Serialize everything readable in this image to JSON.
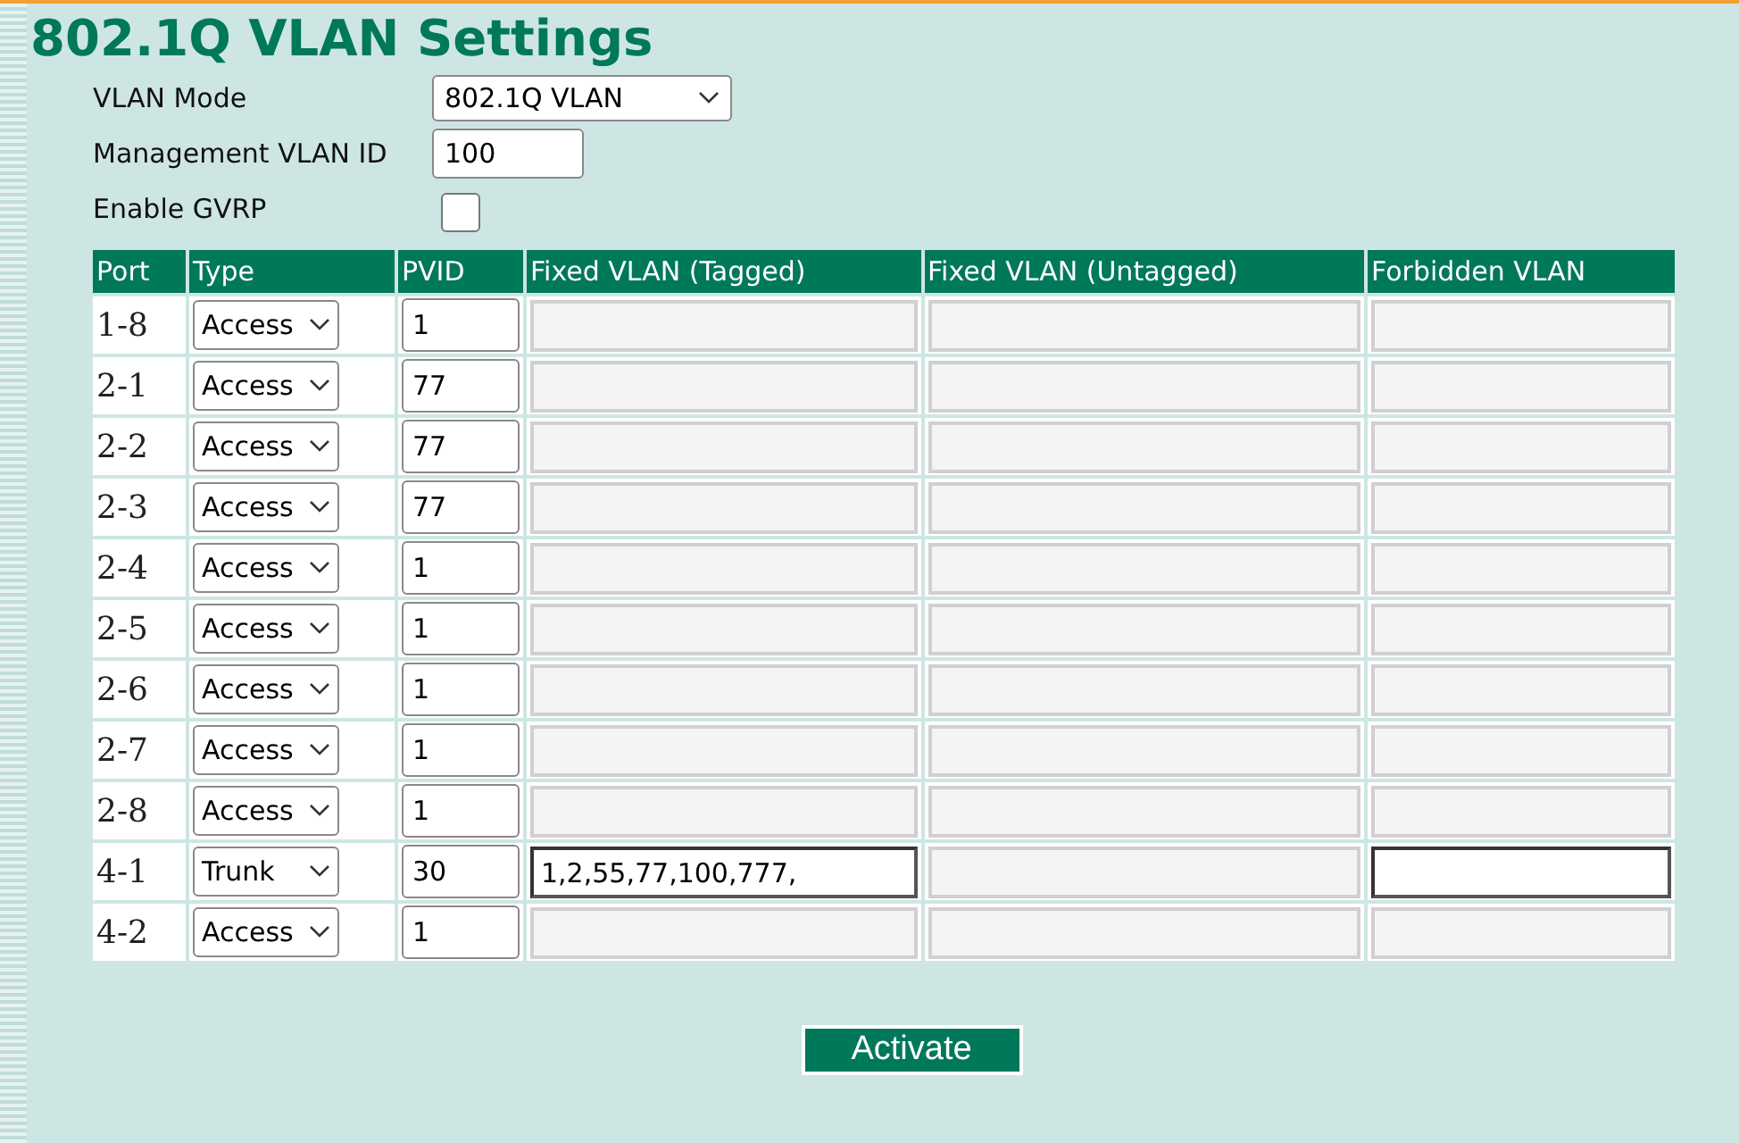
{
  "title": "802.1Q VLAN Settings",
  "settings": {
    "vlan_mode": {
      "label": "VLAN Mode",
      "value": "802.1Q VLAN"
    },
    "management_vlan_id": {
      "label": "Management VLAN ID",
      "value": "100"
    },
    "enable_gvrp": {
      "label": "Enable GVRP",
      "checked": false
    }
  },
  "table": {
    "columns": [
      "Port",
      "Type",
      "PVID",
      "Fixed VLAN (Tagged)",
      "Fixed VLAN (Untagged)",
      "Forbidden VLAN"
    ],
    "rows": [
      {
        "port": "1-8",
        "type": "Access",
        "pvid": "1",
        "tagged": {
          "disabled": true
        },
        "untagged": {
          "disabled": true
        },
        "forbidden": {
          "disabled": true
        }
      },
      {
        "port": "2-1",
        "type": "Access",
        "pvid": "77",
        "tagged": {
          "disabled": true
        },
        "untagged": {
          "disabled": true
        },
        "forbidden": {
          "disabled": true
        }
      },
      {
        "port": "2-2",
        "type": "Access",
        "pvid": "77",
        "tagged": {
          "disabled": true
        },
        "untagged": {
          "disabled": true
        },
        "forbidden": {
          "disabled": true
        }
      },
      {
        "port": "2-3",
        "type": "Access",
        "pvid": "77",
        "tagged": {
          "disabled": true
        },
        "untagged": {
          "disabled": true
        },
        "forbidden": {
          "disabled": true
        }
      },
      {
        "port": "2-4",
        "type": "Access",
        "pvid": "1",
        "tagged": {
          "disabled": true
        },
        "untagged": {
          "disabled": true
        },
        "forbidden": {
          "disabled": true
        }
      },
      {
        "port": "2-5",
        "type": "Access",
        "pvid": "1",
        "tagged": {
          "disabled": true
        },
        "untagged": {
          "disabled": true
        },
        "forbidden": {
          "disabled": true
        }
      },
      {
        "port": "2-6",
        "type": "Access",
        "pvid": "1",
        "tagged": {
          "disabled": true
        },
        "untagged": {
          "disabled": true
        },
        "forbidden": {
          "disabled": true
        }
      },
      {
        "port": "2-7",
        "type": "Access",
        "pvid": "1",
        "tagged": {
          "disabled": true
        },
        "untagged": {
          "disabled": true
        },
        "forbidden": {
          "disabled": true
        }
      },
      {
        "port": "2-8",
        "type": "Access",
        "pvid": "1",
        "tagged": {
          "disabled": true
        },
        "untagged": {
          "disabled": true
        },
        "forbidden": {
          "disabled": true
        }
      },
      {
        "port": "4-1",
        "type": "Trunk",
        "pvid": "30",
        "tagged": {
          "value": "1,2,55,77,100,777,",
          "disabled": false
        },
        "untagged": {
          "disabled": true
        },
        "forbidden": {
          "disabled": false
        }
      },
      {
        "port": "4-2",
        "type": "Access",
        "pvid": "1",
        "tagged": {
          "disabled": true
        },
        "untagged": {
          "disabled": true
        },
        "forbidden": {
          "disabled": true
        }
      }
    ]
  },
  "activate_button": "Activate"
}
